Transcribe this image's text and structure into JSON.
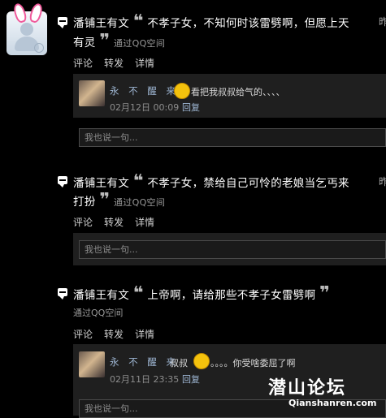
{
  "posts": [
    {
      "author": "潘铺王有文",
      "line1": "不孝子女，不知何时该雷劈啊，但愿上天",
      "line2": "有灵",
      "via": "通过QQ空间",
      "actions": [
        "评论",
        "转发",
        "详情"
      ],
      "reply": {
        "name": "永 不 醒 来",
        "text": "看把我叔叔给气的、、、、",
        "time": "02月12日 00:09",
        "link": "回复"
      },
      "input_placeholder": "我也说一句..."
    },
    {
      "author": "潘铺王有文",
      "line1": "不孝子女，禁给自己可怜的老娘当乞丐来",
      "line2": "打扮",
      "via": "通过QQ空间",
      "actions": [
        "评论",
        "转发",
        "详情"
      ],
      "input_placeholder": "我也说一句..."
    },
    {
      "author": "潘铺王有文",
      "line1": "上帝啊，请给那些不孝子女雷劈啊",
      "via": "通过QQ空间",
      "actions": [
        "评论",
        "转发",
        "详情"
      ],
      "reply": {
        "name": "永 不 醒 来",
        "text_a": "叔叔",
        "text_b": "。。。。你受啥委屈了啊",
        "time": "02月11日 23:35",
        "link": "回复"
      },
      "input_placeholder": "我也说一句..."
    }
  ],
  "quote_open": "❝",
  "quote_close": "❞",
  "cut_char": "昨",
  "watermark": {
    "title": "潜山论坛",
    "url": "Qianshanren.com"
  }
}
